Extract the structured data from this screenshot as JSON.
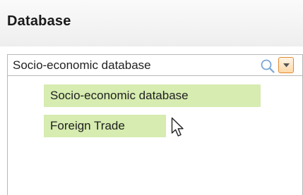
{
  "panel": {
    "title": "Database"
  },
  "select": {
    "value": "Socio-economic database",
    "search_icon": "search-icon",
    "dropdown_icon": "chevron-down-icon"
  },
  "options": [
    {
      "label": "Socio-economic database"
    },
    {
      "label": "Foreign Trade"
    }
  ],
  "colors": {
    "option_highlight": "#d6ecb0",
    "dropdown_button_border": "#e08a2e",
    "search_icon": "#7aa7d6"
  }
}
